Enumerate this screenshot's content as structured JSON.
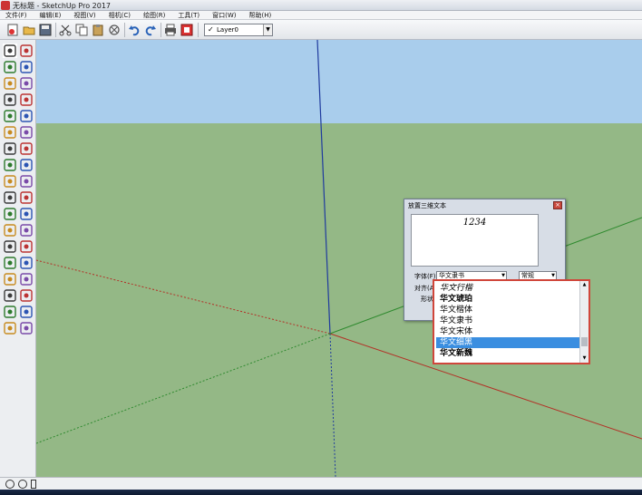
{
  "window": {
    "title": "无标题 - SketchUp Pro 2017"
  },
  "menu": [
    "文件(F)",
    "编辑(E)",
    "视图(V)",
    "相机(C)",
    "绘图(R)",
    "工具(T)",
    "窗口(W)",
    "帮助(H)"
  ],
  "toolbar": {
    "icons": [
      "new-file-icon",
      "open-folder-icon",
      "save-icon",
      "cut-icon",
      "copy-icon",
      "paste-icon",
      "erase-icon",
      "undo-icon",
      "redo-icon",
      "print-icon",
      "model-info-icon"
    ],
    "layer": {
      "check": "✓",
      "value": "Layer0"
    }
  },
  "left_toolbar": {
    "icons": [
      "select-icon",
      "component-icon",
      "paint-bucket-icon",
      "eraser-icon",
      "line-icon",
      "freehand-icon",
      "rectangle-icon",
      "rotated-rectangle-icon",
      "circle-icon",
      "polygon-icon",
      "arc-icon",
      "two-point-arc-icon",
      "three-point-arc-icon",
      "pie-icon",
      "move-icon",
      "push-pull-icon",
      "rotate-icon",
      "follow-me-icon",
      "scale-icon",
      "offset-icon",
      "tape-measure-icon",
      "dimension-icon",
      "protractor-icon",
      "text-icon",
      "axes-icon",
      "3d-text-icon",
      "orbit-icon",
      "pan-icon",
      "zoom-icon",
      "zoom-window-icon",
      "zoom-extents-icon",
      "previous-view-icon",
      "position-camera-icon",
      "look-around-icon",
      "walk-icon",
      "section-plane-icon"
    ]
  },
  "dialog": {
    "title": "放置三维文本",
    "text": "1234",
    "font_label": "字体(F)",
    "font_value": "华文隶书",
    "style_value": "常规",
    "align_label": "对齐(A)",
    "shape_label": "形状"
  },
  "font_dropdown": {
    "options": [
      "华文行楷",
      "华文琥珀",
      "华文楷体",
      "华文隶书",
      "华文宋体",
      "华文细黑",
      "华文新魏"
    ],
    "selected_index": 5
  },
  "colors": {
    "sky": "#a9cdec",
    "ground": "#94b886",
    "axis_blue": "#1f3a9e",
    "axis_red": "#b33026",
    "axis_green": "#2f8a2f",
    "highlight_border": "#d0463b",
    "selection": "#3a8ee0"
  }
}
